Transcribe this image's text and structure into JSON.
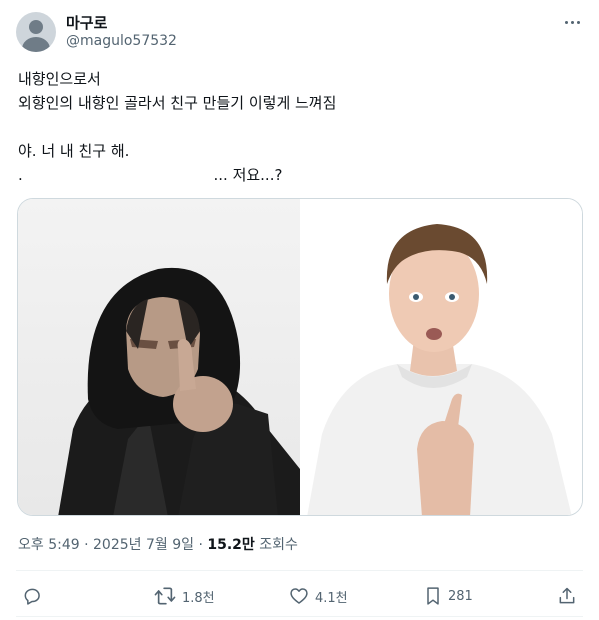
{
  "author": {
    "display_name": "마구로",
    "handle": "@magulo57532",
    "avatar_icon": "default-profile-icon"
  },
  "tweet": {
    "lines": [
      "내향인으로서",
      "외향인의 내향인 골라서 친구 만들기 이렇게 느껴짐",
      "야. 너 내 친구 해.",
      ".                                        ... 저요...?"
    ]
  },
  "media": {
    "images": [
      "hooded-man-pointing",
      "surprised-boy-pointing-at-self"
    ]
  },
  "meta": {
    "time": "오후 5:49",
    "separator": " · ",
    "date": "2025년 7월 9일",
    "separator2": " · ",
    "views_count": "15.2만",
    "views_label": " 조회수"
  },
  "actions": {
    "reply": {
      "icon": "reply-icon",
      "count": ""
    },
    "retweet": {
      "icon": "retweet-icon",
      "count": "1.8천"
    },
    "like": {
      "icon": "heart-icon",
      "count": "4.1천"
    },
    "bookmark": {
      "icon": "bookmark-icon",
      "count": "281"
    },
    "share": {
      "icon": "share-icon",
      "count": ""
    }
  },
  "colors": {
    "text_primary": "#0f1419",
    "text_secondary": "#536471",
    "border": "#cfd9de"
  }
}
